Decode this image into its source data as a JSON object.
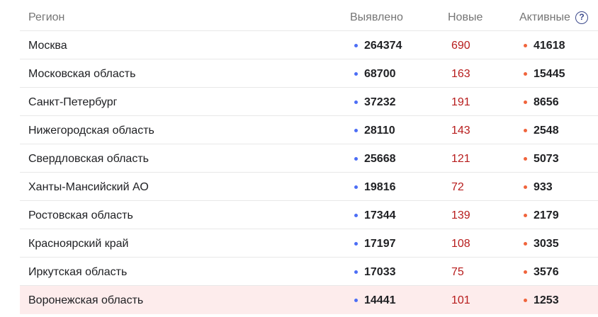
{
  "header": {
    "region": "Регион",
    "detected": "Выявлено",
    "new": "Новые",
    "active": "Активные",
    "help": "?"
  },
  "colors": {
    "detected_dot": "#4c6ef5",
    "active_dot": "#f0643c",
    "new_text": "#b71c1c",
    "highlight_row": "#fdecec"
  },
  "rows": [
    {
      "region": "Москва",
      "detected": "264374",
      "new": "690",
      "active": "41618"
    },
    {
      "region": "Московская область",
      "detected": "68700",
      "new": "163",
      "active": "15445"
    },
    {
      "region": "Санкт-Петербург",
      "detected": "37232",
      "new": "191",
      "active": "8656"
    },
    {
      "region": "Нижегородская область",
      "detected": "28110",
      "new": "143",
      "active": "2548"
    },
    {
      "region": "Свердловская область",
      "detected": "25668",
      "new": "121",
      "active": "5073"
    },
    {
      "region": "Ханты-Мансийский АО",
      "detected": "19816",
      "new": "72",
      "active": "933"
    },
    {
      "region": "Ростовская область",
      "detected": "17344",
      "new": "139",
      "active": "2179"
    },
    {
      "region": "Красноярский край",
      "detected": "17197",
      "new": "108",
      "active": "3035"
    },
    {
      "region": "Иркутская область",
      "detected": "17033",
      "new": "75",
      "active": "3576"
    },
    {
      "region": "Воронежская область",
      "detected": "14441",
      "new": "101",
      "active": "1253"
    }
  ]
}
